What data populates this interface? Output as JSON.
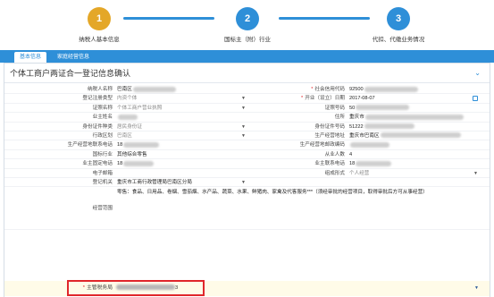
{
  "steps": [
    {
      "num": "1",
      "label": "纳税人基本信息",
      "color": "#e4a728"
    },
    {
      "num": "2",
      "label": "国标主（附）行业",
      "color": "#2e8fd8"
    },
    {
      "num": "3",
      "label": "代扣、代缴业务情况",
      "color": "#2e8fd8"
    }
  ],
  "tabs": {
    "basic": "基本信息",
    "family": "家庭经营信息"
  },
  "panel_title": "个体工商户两证合一登记信息确认",
  "fields": {
    "taxpayer_name_label": "纳税人名称",
    "taxpayer_name": "巴南区",
    "credit_code_label": "社会信用代码",
    "credit_code": "92500",
    "reg_type_label": "登记注册类型",
    "reg_type": "内资个体",
    "open_date_label": "开业（设立）日期",
    "open_date": "2017-08-07",
    "cert_name_label": "证照名称",
    "cert_name": "个体工商户营业执照",
    "cert_no_label": "证照号码",
    "cert_no": "50",
    "owner_name_label": "业主姓名",
    "owner_name": "",
    "address_label": "住所",
    "address": "重庆市",
    "id_type_label": "身份证件种类",
    "id_type": "居民身份证",
    "id_no_label": "身份证件号码",
    "id_no": "51222",
    "district_label": "行政区划",
    "district": "巴南区",
    "biz_address_label": "生产经营地址",
    "biz_address": "重庆市巴南区",
    "biz_phone_label": "生产经营地联系电话",
    "biz_phone": "18",
    "biz_postcode_label": "生产经营地邮政编码",
    "biz_postcode": "",
    "industry_label": "国标行业",
    "industry": "其他综合零售",
    "staff_label": "从业人数",
    "staff": "4",
    "fixed_phone_label": "业主固定电话",
    "fixed_phone": "18",
    "mobile_label": "业主联系电话",
    "mobile": "18",
    "email_label": "电子邮箱",
    "email": "",
    "form_label": "组成形式",
    "form": "个人经营",
    "authority_label": "登记机关",
    "authority": "重庆市工商行政管理局巴南区分局",
    "scope_label": "经营范围",
    "scope": "零售：食品、日用品、卷烟、雪茄烟、水产品、蔬菜、水果、鲜猪肉、家禽及代客服务***（须经审批的经营项目，取得审批后方可从事经营）",
    "tax_office_label": "主管税务局",
    "tax_office": "3"
  },
  "colors": {
    "accent": "#2e8fd8",
    "required": "#e0262b",
    "step_active": "#e4a728"
  }
}
